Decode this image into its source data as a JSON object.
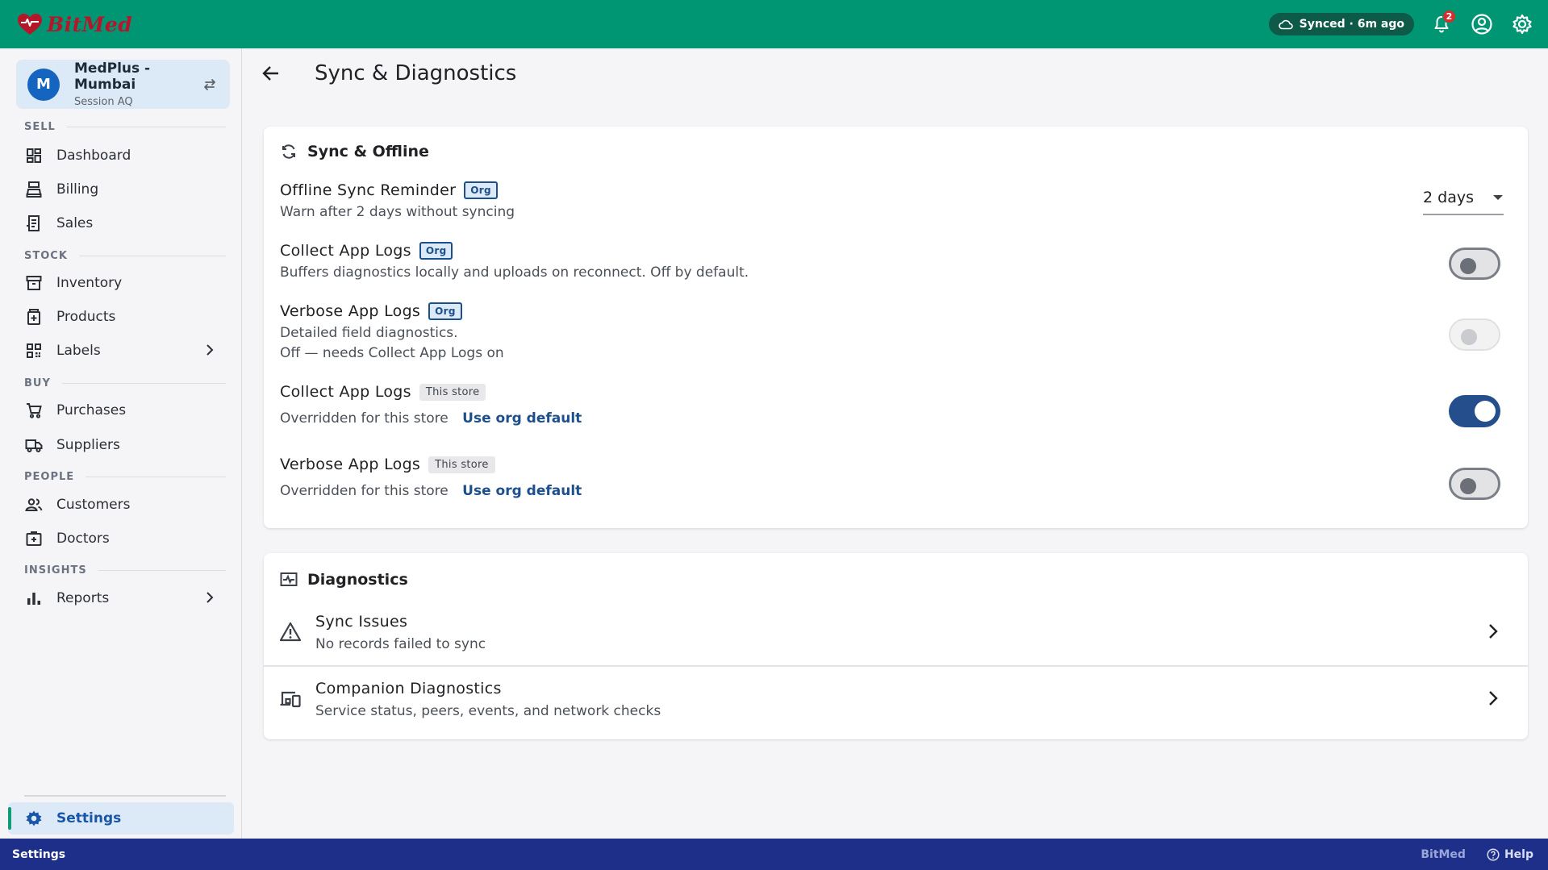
{
  "app": {
    "brand": "BitMed",
    "sync_status": "Synced · 6m ago",
    "notification_count": "2",
    "colors": {
      "topbar": "#009673",
      "accent": "#1c4f8c",
      "statusbar": "#1e2f8a"
    }
  },
  "store": {
    "avatar_letter": "M",
    "name": "MedPlus - Mumbai",
    "session": "Session AQ"
  },
  "sidebar": {
    "sections": {
      "sell": "SELL",
      "stock": "STOCK",
      "buy": "BUY",
      "people": "PEOPLE",
      "insights": "INSIGHTS"
    },
    "items": {
      "dashboard": "Dashboard",
      "billing": "Billing",
      "sales": "Sales",
      "inventory": "Inventory",
      "products": "Products",
      "labels": "Labels",
      "purchases": "Purchases",
      "suppliers": "Suppliers",
      "customers": "Customers",
      "doctors": "Doctors",
      "reports": "Reports",
      "settings": "Settings"
    }
  },
  "page": {
    "title": "Sync & Diagnostics"
  },
  "sync_card": {
    "title": "Sync & Offline",
    "settings": [
      {
        "title": "Offline Sync Reminder",
        "tag": "Org",
        "desc": "Warn after 2 days without syncing",
        "value": "2 days"
      },
      {
        "title": "Collect App Logs",
        "tag": "Org",
        "desc": "Buffers diagnostics locally and uploads on reconnect. Off by default.",
        "state": "off"
      },
      {
        "title": "Verbose App Logs",
        "tag": "Org",
        "desc": "Detailed field diagnostics.",
        "desc2": "Off — needs Collect App Logs on",
        "state": "disabled"
      },
      {
        "title": "Collect App Logs",
        "tag": "This store",
        "desc": "Overridden for this store",
        "link": "Use org default",
        "state": "on"
      },
      {
        "title": "Verbose App Logs",
        "tag": "This store",
        "desc": "Overridden for this store",
        "link": "Use org default",
        "state": "off"
      }
    ]
  },
  "diag_card": {
    "title": "Diagnostics",
    "rows": [
      {
        "title": "Sync Issues",
        "sub": "No records failed to sync",
        "icon": "warning-icon"
      },
      {
        "title": "Companion Diagnostics",
        "sub": "Service status, peers, events, and network checks",
        "icon": "devices-icon"
      }
    ]
  },
  "statusbar": {
    "left": "Settings",
    "brand": "BitMed",
    "help": "Help"
  }
}
